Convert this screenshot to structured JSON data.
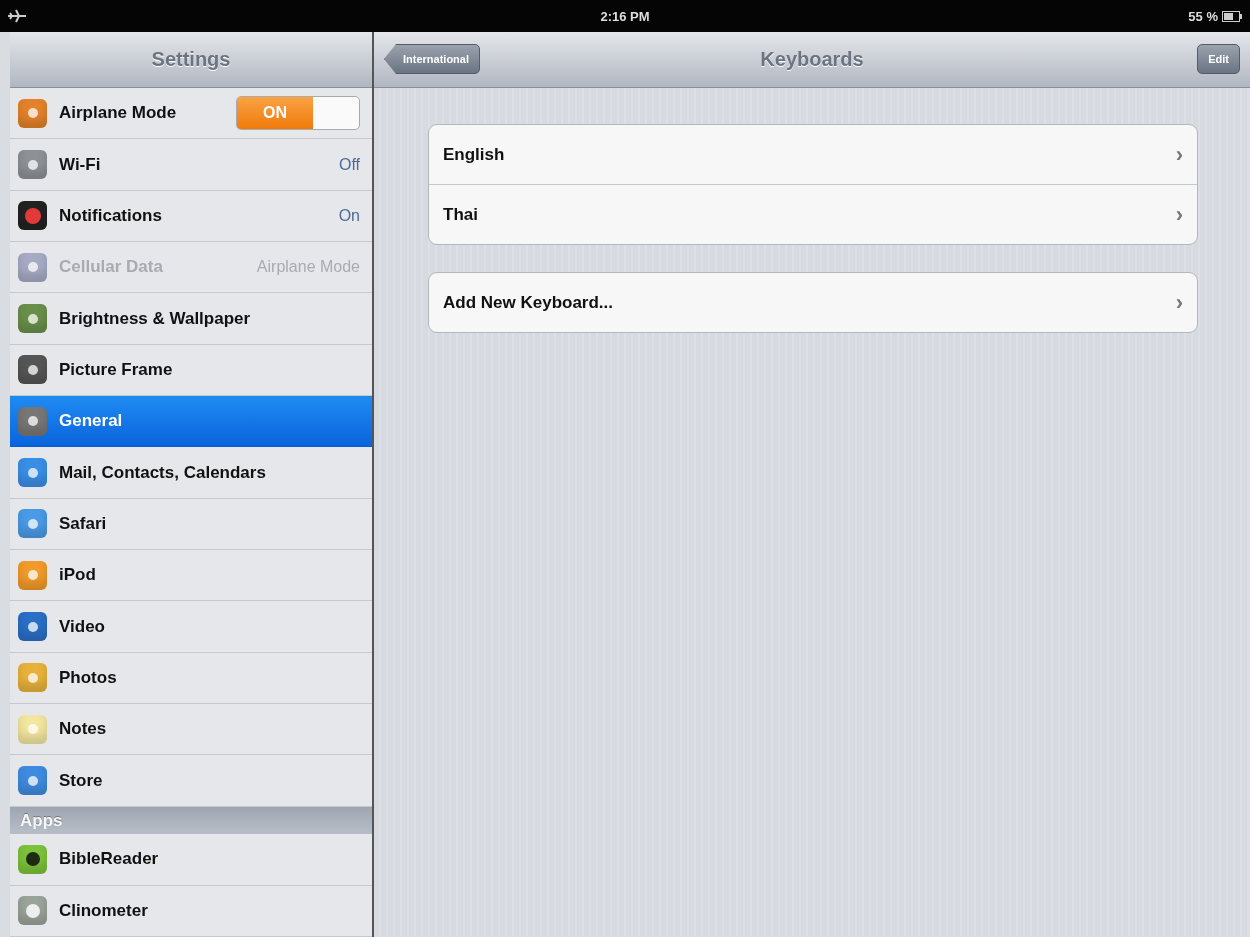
{
  "status_bar": {
    "time": "2:16 PM",
    "battery": "55 %"
  },
  "sidebar": {
    "title": "Settings",
    "items": [
      {
        "kind": "toggle",
        "label": "Airplane Mode",
        "selected": false,
        "disabled": false,
        "toggle": {
          "on": true,
          "label": "ON"
        }
      },
      {
        "kind": "value",
        "label": "Wi-Fi",
        "value": "Off",
        "selected": false,
        "disabled": false
      },
      {
        "kind": "value",
        "label": "Notifications",
        "value": "On",
        "selected": false,
        "disabled": false
      },
      {
        "kind": "value",
        "label": "Cellular Data",
        "value": "Airplane Mode",
        "selected": false,
        "disabled": true
      },
      {
        "kind": "plain",
        "label": "Brightness & Wallpaper",
        "selected": false,
        "disabled": false
      },
      {
        "kind": "plain",
        "label": "Picture Frame",
        "selected": false,
        "disabled": false
      },
      {
        "kind": "plain",
        "label": "General",
        "selected": true,
        "disabled": false
      },
      {
        "kind": "plain",
        "label": "Mail, Contacts, Calendars",
        "selected": false,
        "disabled": false
      },
      {
        "kind": "plain",
        "label": "Safari",
        "selected": false,
        "disabled": false
      },
      {
        "kind": "plain",
        "label": "iPod",
        "selected": false,
        "disabled": false
      },
      {
        "kind": "plain",
        "label": "Video",
        "selected": false,
        "disabled": false
      },
      {
        "kind": "plain",
        "label": "Photos",
        "selected": false,
        "disabled": false
      },
      {
        "kind": "plain",
        "label": "Notes",
        "selected": false,
        "disabled": false
      },
      {
        "kind": "plain",
        "label": "Store",
        "selected": false,
        "disabled": false
      }
    ],
    "section_title": "Apps",
    "apps": [
      {
        "label": "BibleReader",
        "selected": false
      },
      {
        "label": "Clinometer",
        "selected": false
      }
    ]
  },
  "nav_bar": {
    "back_button": "International",
    "title": "Keyboards",
    "edit_button": "Edit"
  },
  "groups": [
    [
      {
        "label": "English",
        "chevron": "›"
      },
      {
        "label": "Thai",
        "chevron": "›"
      }
    ],
    [
      {
        "label": "Add New Keyboard...",
        "chevron": "›"
      }
    ]
  ]
}
